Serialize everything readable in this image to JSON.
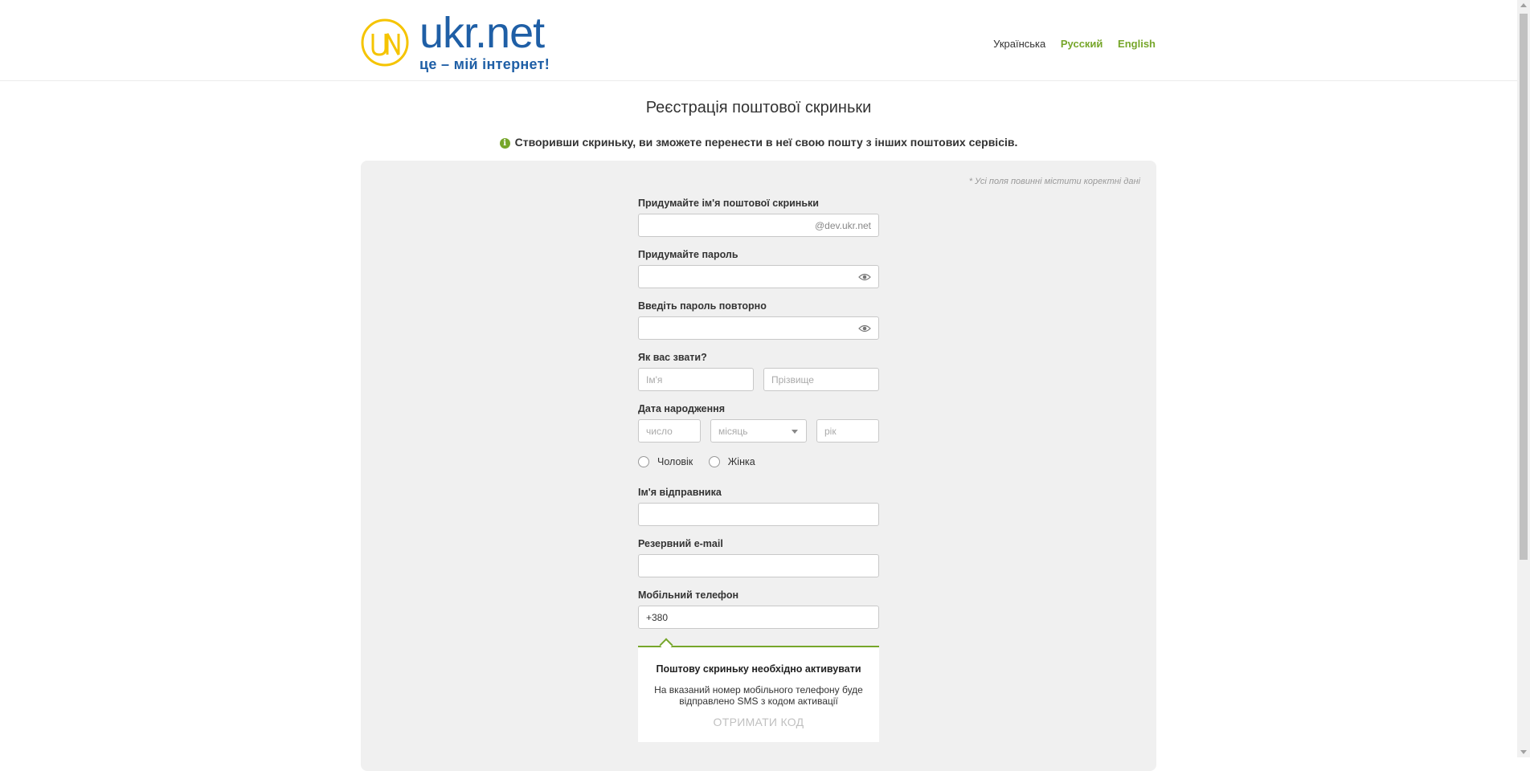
{
  "header": {
    "logo_word": "ukr.net",
    "logo_slogan": "це – мій інтернет!",
    "languages": [
      {
        "label": "Українська",
        "current": true
      },
      {
        "label": "Русский",
        "current": false
      },
      {
        "label": "English",
        "current": false
      }
    ]
  },
  "page_title": "Реєстрація поштової скриньки",
  "notice": "Створивши скриньку, ви зможете перенести в неї свою пошту з інших поштових сервісів.",
  "required_note": "* Усі поля повинні містити коректні дані",
  "form": {
    "mailbox": {
      "label": "Придумайте ім'я поштової скриньки",
      "value": "",
      "suffix": "@dev.ukr.net"
    },
    "password": {
      "label": "Придумайте пароль",
      "value": ""
    },
    "password_repeat": {
      "label": "Введіть пароль повторно",
      "value": ""
    },
    "name": {
      "label": "Як вас звати?",
      "first_placeholder": "Ім'я",
      "last_placeholder": "Прізвище"
    },
    "birth_date": {
      "label": "Дата народження",
      "day_placeholder": "число",
      "month_placeholder": "місяць",
      "year_placeholder": "рік"
    },
    "gender": {
      "male": "Чоловік",
      "female": "Жінка"
    },
    "sender_name": {
      "label": "Ім'я відправника",
      "value": ""
    },
    "backup_email": {
      "label": "Резервний e-mail",
      "value": ""
    },
    "phone": {
      "label": "Мобільний телефон",
      "value": "+380"
    }
  },
  "activation": {
    "title": "Поштову скриньку необхідно активувати",
    "text": "На вказаний номер мобільного телефону буде відправлено SMS з кодом активації",
    "button": "ОТРИМАТИ КОД"
  },
  "colors": {
    "accent": "#76a62a",
    "brand_blue": "#1f5fa6",
    "brand_yellow": "#f5c400",
    "panel_bg": "#f0f0f0"
  }
}
